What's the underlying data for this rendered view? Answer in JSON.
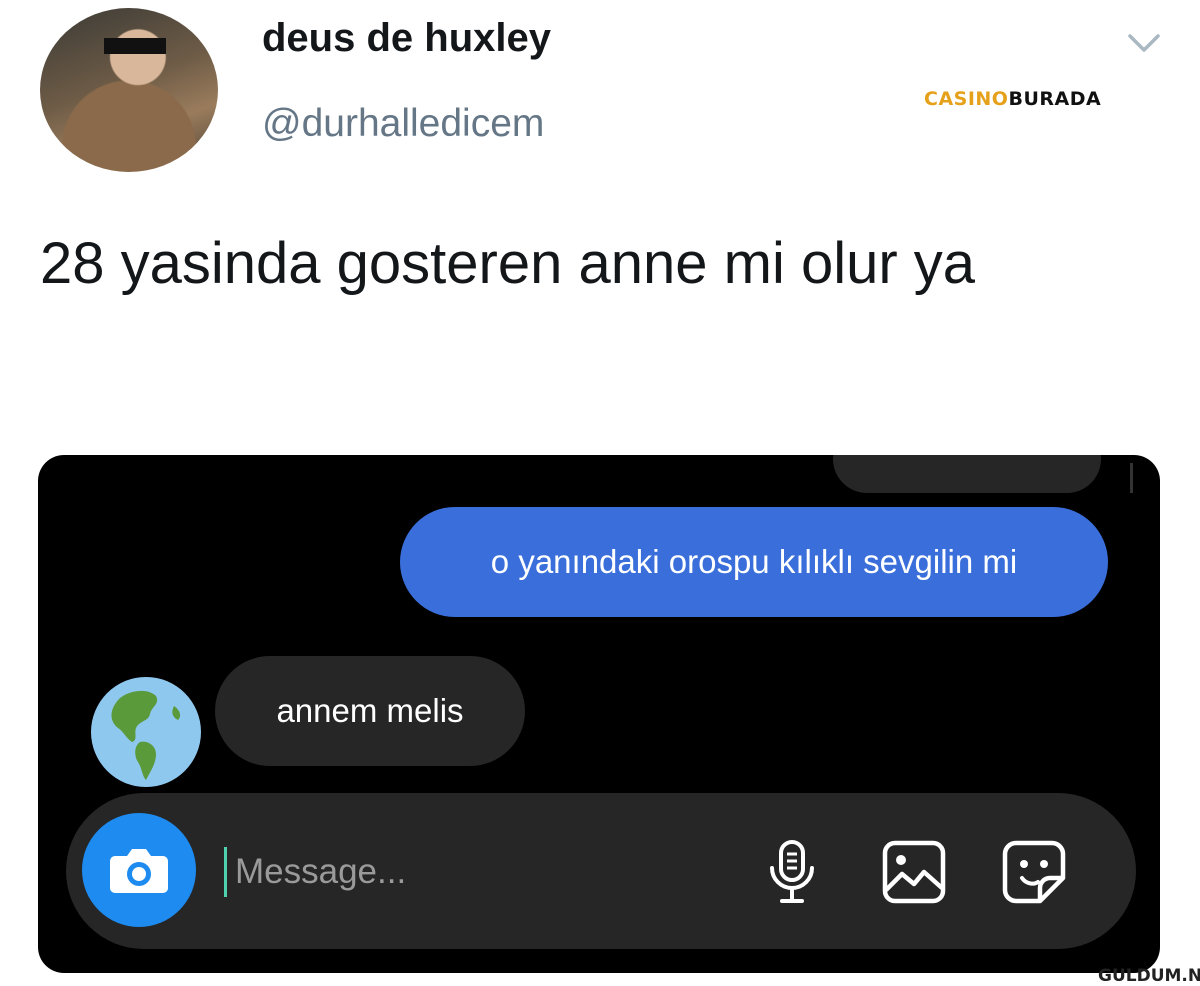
{
  "tweet": {
    "display_name": "deus de huxley",
    "handle": "@durhalledicem",
    "text": "28 yasinda gosteren anne mi olur ya"
  },
  "brand_overlay": {
    "part1": "CASINO",
    "part2": "BURADA"
  },
  "dm": {
    "sent_message": "o yanındaki orospu kılıklı sevgilin mi",
    "received_message": "annem melis",
    "composer": {
      "placeholder": "Message..."
    },
    "icons": [
      "camera-icon",
      "microphone-icon",
      "gallery-icon",
      "sticker-icon"
    ]
  },
  "watermark": "GULDUM.NET",
  "colors": {
    "sent_bubble": "#3a6fdb",
    "received_bubble": "#262626",
    "camera_button": "#1e8bf0"
  }
}
